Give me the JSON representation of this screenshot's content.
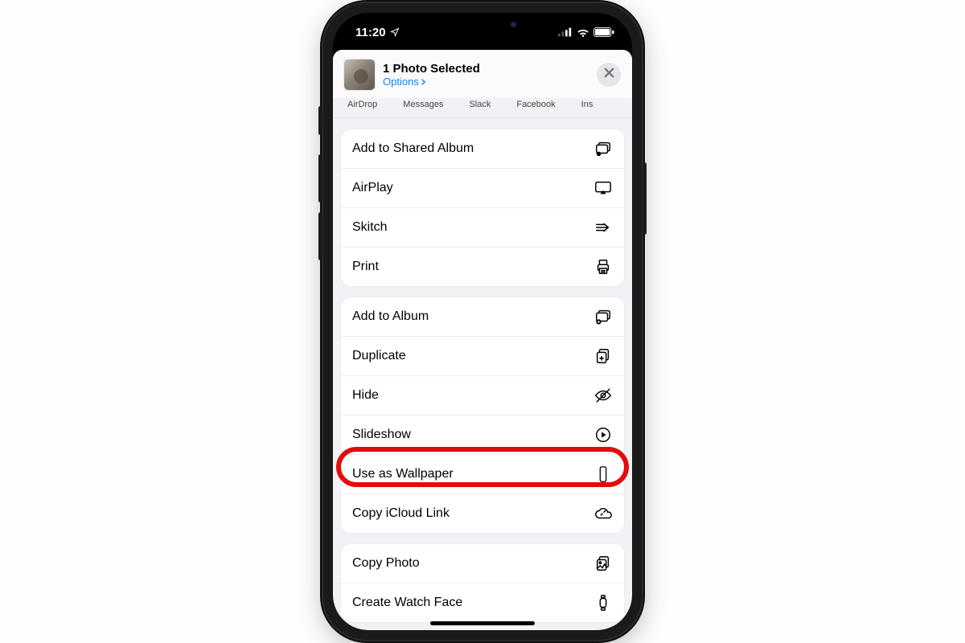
{
  "status": {
    "time": "11:20"
  },
  "header": {
    "title": "1 Photo Selected",
    "options_label": "Options"
  },
  "share_targets": [
    "AirDrop",
    "Messages",
    "Slack",
    "Facebook",
    "Ins"
  ],
  "groups": [
    {
      "rows": [
        {
          "label": "Add to Shared Album",
          "icon": "shared-album-icon"
        },
        {
          "label": "AirPlay",
          "icon": "airplay-icon"
        },
        {
          "label": "Skitch",
          "icon": "skitch-icon"
        },
        {
          "label": "Print",
          "icon": "print-icon"
        }
      ]
    },
    {
      "rows": [
        {
          "label": "Add to Album",
          "icon": "album-add-icon"
        },
        {
          "label": "Duplicate",
          "icon": "duplicate-icon"
        },
        {
          "label": "Hide",
          "icon": "hide-icon"
        },
        {
          "label": "Slideshow",
          "icon": "play-circle-icon",
          "highlighted": true
        },
        {
          "label": "Use as Wallpaper",
          "icon": "phone-outline-icon"
        },
        {
          "label": "Copy iCloud Link",
          "icon": "cloud-link-icon"
        }
      ]
    },
    {
      "rows": [
        {
          "label": "Copy Photo",
          "icon": "copy-photo-icon"
        },
        {
          "label": "Create Watch Face",
          "icon": "watch-icon"
        }
      ]
    }
  ],
  "annotation": {
    "highlight_color": "#e40b0b"
  }
}
